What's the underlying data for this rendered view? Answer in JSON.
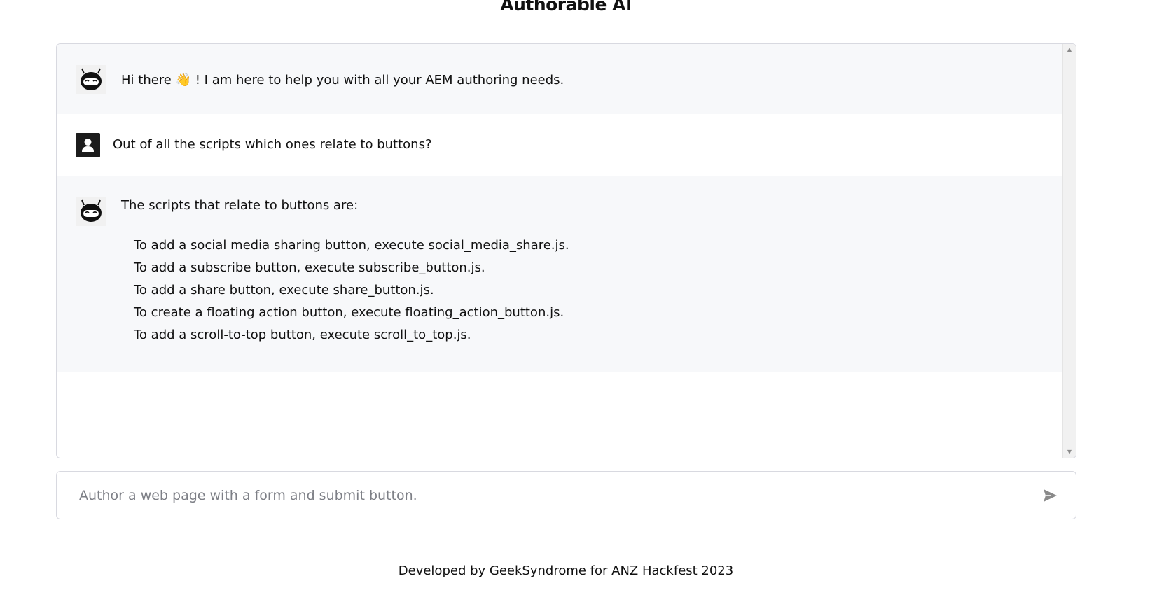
{
  "header": {
    "title": "Authorable AI"
  },
  "chat": {
    "messages": [
      {
        "role": "bot",
        "text": "Hi there 👋 ! I am here to help you with all your AEM authoring needs."
      },
      {
        "role": "user",
        "text": "Out of all the scripts which ones relate to buttons?"
      },
      {
        "role": "bot",
        "text": "The scripts that relate to buttons are:",
        "items": [
          "To add a social media sharing button, execute social_media_share.js.",
          "To add a subscribe button, execute subscribe_button.js.",
          "To add a share button, execute share_button.js.",
          "To create a floating action button, execute floating_action_button.js.",
          "To add a scroll-to-top button, execute scroll_to_top.js."
        ]
      }
    ]
  },
  "input": {
    "placeholder": "Author a web page with a form and submit button.",
    "value": ""
  },
  "icons": {
    "bot_avatar": "robot-icon",
    "user_avatar": "user-icon",
    "send": "send-icon",
    "scroll_up": "scroll-up-arrow",
    "scroll_down": "scroll-down-arrow"
  },
  "colors": {
    "bot_message_bg": "#f7f8fa",
    "user_avatar_bg": "#1c1c1c",
    "border": "#d8d9e0",
    "placeholder_text": "#7d7f86",
    "send_icon": "#8a8a8a"
  },
  "footer": {
    "text": "Developed by GeekSyndrome for ANZ Hackfest 2023"
  }
}
